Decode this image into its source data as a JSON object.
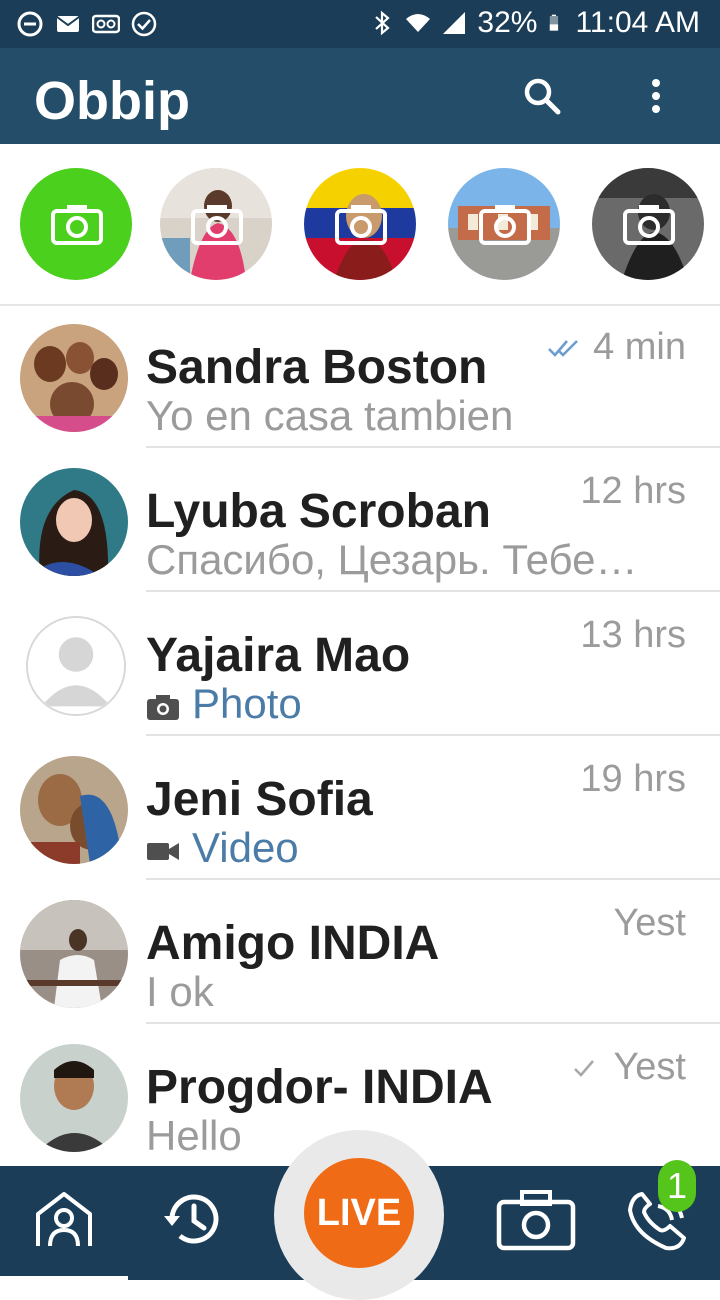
{
  "status_bar": {
    "icons_left": [
      "do-not-disturb-icon",
      "mail-icon",
      "voicemail-icon",
      "check-circle-icon"
    ],
    "icons_right": [
      "bluetooth-icon",
      "wifi-icon",
      "signal-icon",
      "battery-icon"
    ],
    "battery": "32%",
    "time": "11:04 AM"
  },
  "app_bar": {
    "title": "Obbip",
    "search_icon": "search-icon",
    "menu_icon": "more-vert-icon"
  },
  "stories": [
    {
      "type": "add",
      "icon": "camera-icon",
      "color": "#4cd01e"
    },
    {
      "type": "story",
      "icon": "camera-icon"
    },
    {
      "type": "story",
      "icon": "camera-icon"
    },
    {
      "type": "story",
      "icon": "camera-icon"
    },
    {
      "type": "story",
      "icon": "camera-icon"
    }
  ],
  "chats": [
    {
      "name": "Sandra Boston",
      "message": "Yo en casa tambien",
      "time": "4 min",
      "status": "double-check-icon"
    },
    {
      "name": "Lyuba Scroban",
      "message": "Спасибо, Цезарь. Тебе…",
      "time": "12 hrs"
    },
    {
      "name": "Yajaira Mao",
      "message": "Photo",
      "time": "13 hrs",
      "media_icon": "camera-icon"
    },
    {
      "name": "Jeni Sofia",
      "message": "Video",
      "time": "19 hrs",
      "media_icon": "videocam-icon"
    },
    {
      "name": "Amigo INDIA",
      "message": "I ok",
      "time": "Yest"
    },
    {
      "name": "Progdor- INDIA",
      "message": "Hello",
      "time": "Yest",
      "status": "check-icon"
    }
  ],
  "bottom_nav": {
    "items": [
      "contacts-icon",
      "history-icon",
      "camera-icon",
      "phone-icon"
    ],
    "live_label": "LIVE",
    "badge": "1"
  },
  "colors": {
    "status_bar": "#1b3d57",
    "app_bar": "#234d68",
    "accent_green": "#4cd01e",
    "live_orange": "#ef6b16",
    "media_blue": "#4b7ca8"
  }
}
